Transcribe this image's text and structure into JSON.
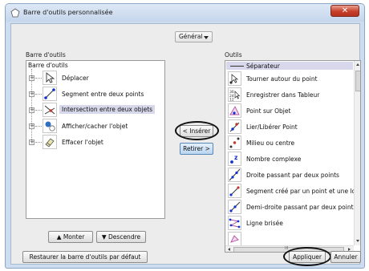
{
  "window": {
    "title": "Barre d'outils personnalisée"
  },
  "combo": {
    "value": "Général"
  },
  "left": {
    "label": "Barre d'outils",
    "root": "Barre d'outils",
    "items": [
      {
        "label": "Déplacer",
        "icon": "cursor-arrow-icon"
      },
      {
        "label": "Segment entre deux points",
        "icon": "segment-icon"
      },
      {
        "label": "Intersection entre deux objets",
        "icon": "intersection-icon"
      },
      {
        "label": "Afficher/cacher l'objet",
        "icon": "show-hide-icon"
      },
      {
        "label": "Effacer l'objet",
        "icon": "eraser-icon"
      }
    ],
    "move_up": "▲ Monter",
    "move_down": "▼ Descendre"
  },
  "middle": {
    "insert": "< Insérer",
    "remove": "Retirer >"
  },
  "right": {
    "label": "Outils",
    "separator": "Séparateur",
    "items": [
      {
        "label": "Tourner autour du point",
        "icon": "rotate-icon"
      },
      {
        "label": "Enregistrer dans Tableur",
        "icon": "spreadsheet-record-icon"
      },
      {
        "label": "Point sur Objet",
        "icon": "point-on-object-icon"
      },
      {
        "label": "Lier/Libérer Point",
        "icon": "attach-detach-icon"
      },
      {
        "label": "Milieu ou centre",
        "icon": "midpoint-icon"
      },
      {
        "label": "Nombre complexe",
        "icon": "complex-number-icon"
      },
      {
        "label": "Droite passant par deux points",
        "icon": "line-icon"
      },
      {
        "label": "Segment créé par un point et une longueur",
        "icon": "segment-length-icon"
      },
      {
        "label": "Demi-droite passant par deux points",
        "icon": "ray-icon"
      },
      {
        "label": "Ligne brisée",
        "icon": "polyline-icon"
      }
    ],
    "scroll_mid": "III"
  },
  "footer": {
    "restore": "Restaurer la barre d'outils par défaut",
    "apply": "Appliquer",
    "cancel": "Annuler"
  },
  "colors": {
    "selection": "#d8d8ec",
    "accent_blue": "#1030d0",
    "close_red": "#c8402c"
  }
}
